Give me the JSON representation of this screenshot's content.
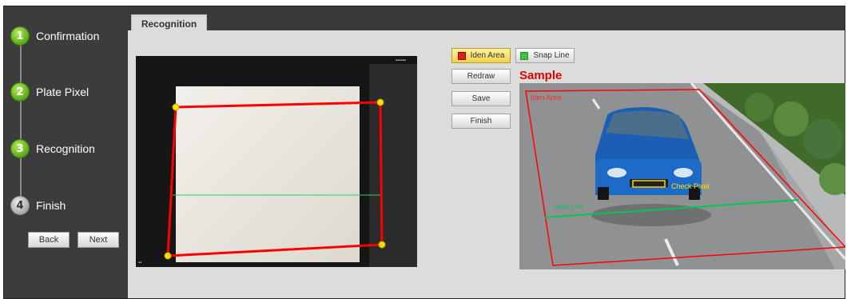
{
  "sidebar": {
    "steps": [
      {
        "num": "1",
        "label": "Confirmation"
      },
      {
        "num": "2",
        "label": "Plate Pixel"
      },
      {
        "num": "3",
        "label": "Recognition"
      },
      {
        "num": "4",
        "label": "Finish"
      }
    ],
    "back_label": "Back",
    "next_label": "Next"
  },
  "tab": {
    "label": "Recognition"
  },
  "toolbar": {
    "iden_area_label": "Iden Area",
    "snap_line_label": "Snap Line",
    "redraw_label": "Redraw",
    "save_label": "Save",
    "finish_label": "Finish"
  },
  "sample": {
    "title": "Sample",
    "iden_area_text": "Iden Area",
    "check_pixel_text": "Check  Pixel",
    "snap_line_text": "Snap Line"
  },
  "colors": {
    "iden_area": "#ff0000",
    "snap_line": "#00c853",
    "active_step": "#6fc425",
    "sample_title": "#e00000"
  }
}
